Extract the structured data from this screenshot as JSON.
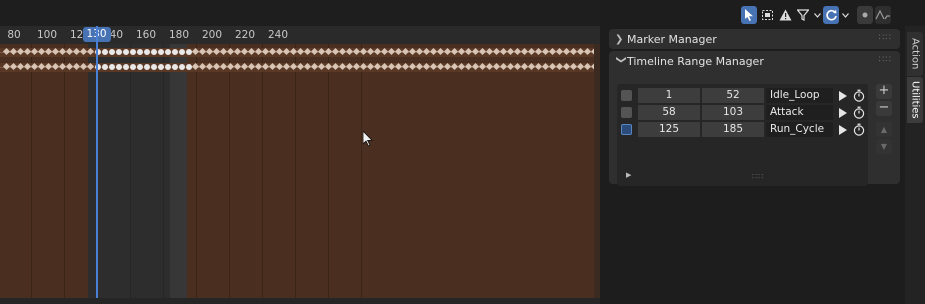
{
  "timeline": {
    "ruler_ticks": [
      "80",
      "100",
      "120",
      "140",
      "160",
      "180",
      "200",
      "220",
      "240"
    ],
    "current_frame": "130",
    "range_start": 125,
    "range_end": 185
  },
  "header_tools": [
    {
      "icon": "select-cursor-icon",
      "active": true
    },
    {
      "icon": "box-select-icon",
      "active": false
    },
    {
      "icon": "warning-icon",
      "active": false
    },
    {
      "icon": "filter-icon",
      "active": false
    },
    {
      "icon": "chevron-down-icon",
      "active": false
    },
    {
      "icon": "refresh-icon",
      "active": true
    },
    {
      "icon": "chevron-down-icon",
      "active": false
    },
    {
      "icon": "dot-toggle-icon",
      "active": false
    },
    {
      "icon": "curve-icon",
      "active": false
    }
  ],
  "panels": {
    "marker_manager": {
      "title": "Marker Manager",
      "expanded": false
    },
    "timeline_range_manager": {
      "title": "Timeline Range Manager",
      "expanded": true
    }
  },
  "ranges": [
    {
      "start": "1",
      "end": "52",
      "name": "Idle_Loop",
      "active": false
    },
    {
      "start": "58",
      "end": "103",
      "name": "Attack",
      "active": false
    },
    {
      "start": "125",
      "end": "185",
      "name": "Run_Cycle",
      "active": true
    }
  ],
  "side_buttons": [
    "+",
    "−",
    "▲",
    "▼"
  ],
  "tabs": [
    "Action",
    "Utilities"
  ],
  "colors": {
    "accent": "#4772b3",
    "action_bg": "#4a2e1f",
    "range_bg": "#2d2d2d"
  }
}
